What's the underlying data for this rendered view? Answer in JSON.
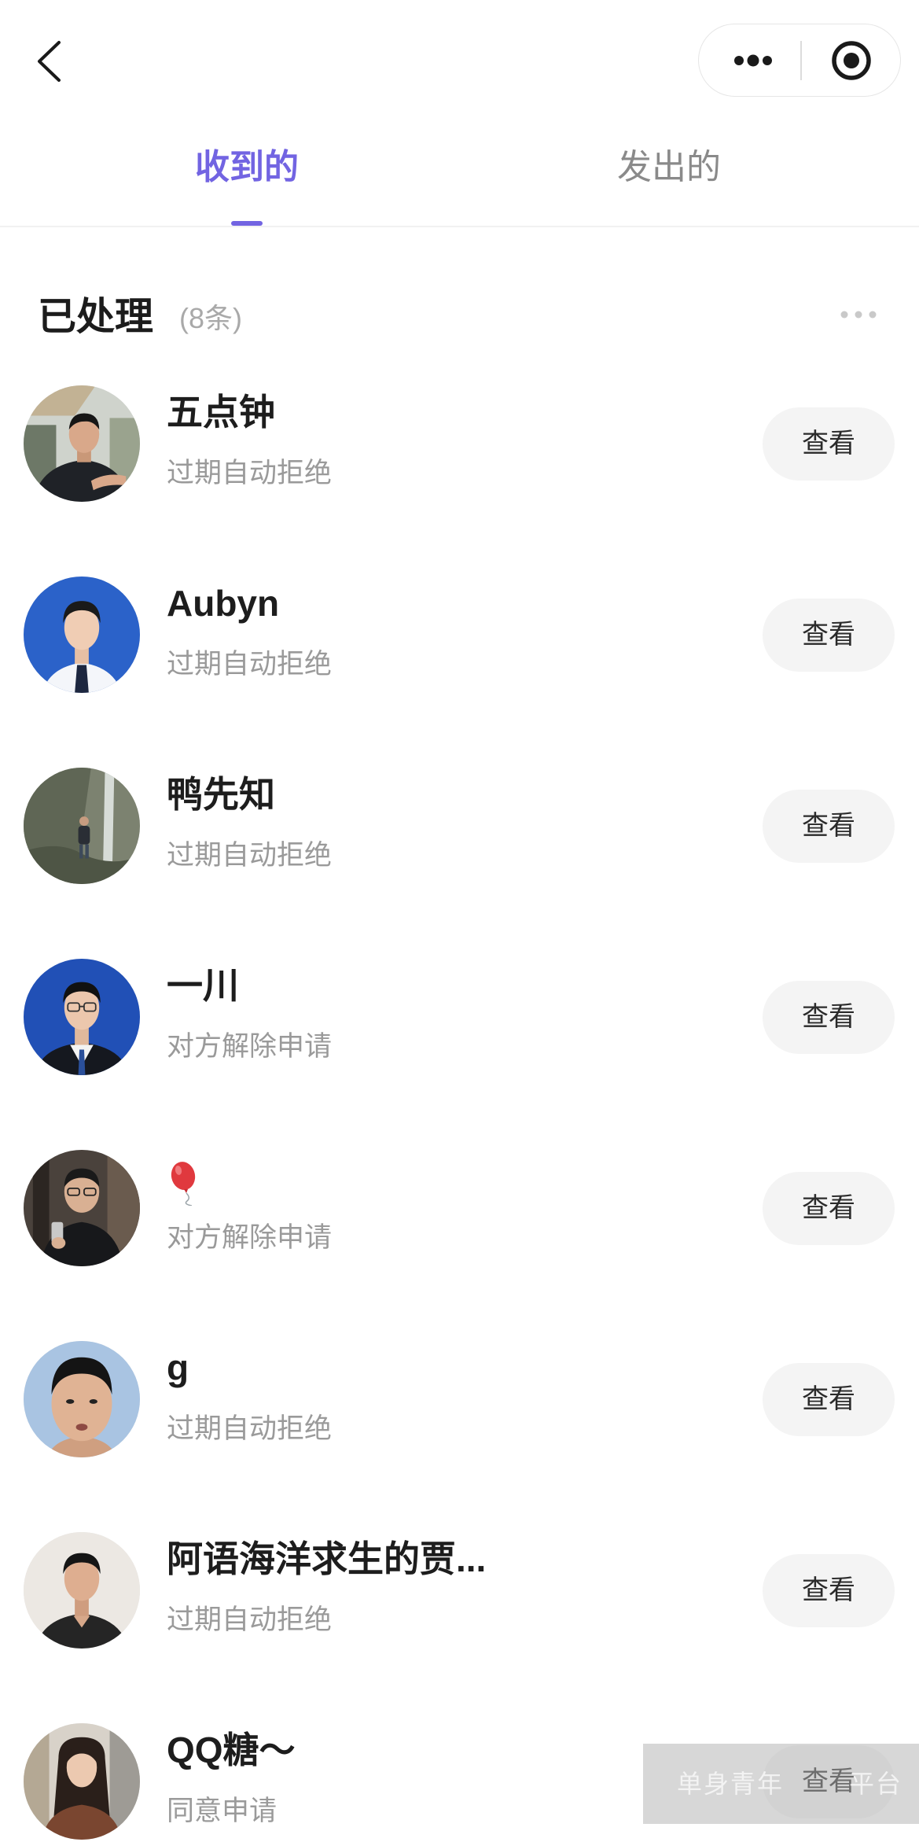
{
  "nav": {
    "back_icon": "chevron-left-icon",
    "more_icon": "more-dots-icon",
    "close_icon": "target-icon"
  },
  "colors": {
    "accent": "#7264e2"
  },
  "tabs": [
    {
      "label": "收到的",
      "active": true
    },
    {
      "label": "发出的",
      "active": false
    }
  ],
  "section": {
    "title": "已处理",
    "count": "(8条)",
    "more_icon": "more-dots-icon"
  },
  "list": {
    "items": [
      {
        "name": "五点钟",
        "status": "过期自动拒绝",
        "action": "查看"
      },
      {
        "name": "Aubyn",
        "status": "过期自动拒绝",
        "action": "查看"
      },
      {
        "name": "鸭先知",
        "status": "过期自动拒绝",
        "action": "查看"
      },
      {
        "name": "一川",
        "status": "对方解除申请",
        "action": "查看"
      },
      {
        "name_icon": "balloon-icon",
        "status": "对方解除申请",
        "action": "查看"
      },
      {
        "name": "g",
        "status": "过期自动拒绝",
        "action": "查看"
      },
      {
        "name": "阿语海洋求生的贾...",
        "status": "过期自动拒绝",
        "action": "查看"
      },
      {
        "name": "QQ糖～",
        "status": "同意申请",
        "action": "查看"
      }
    ]
  },
  "watermark": {
    "left": "单身青年",
    "right": "平台"
  }
}
